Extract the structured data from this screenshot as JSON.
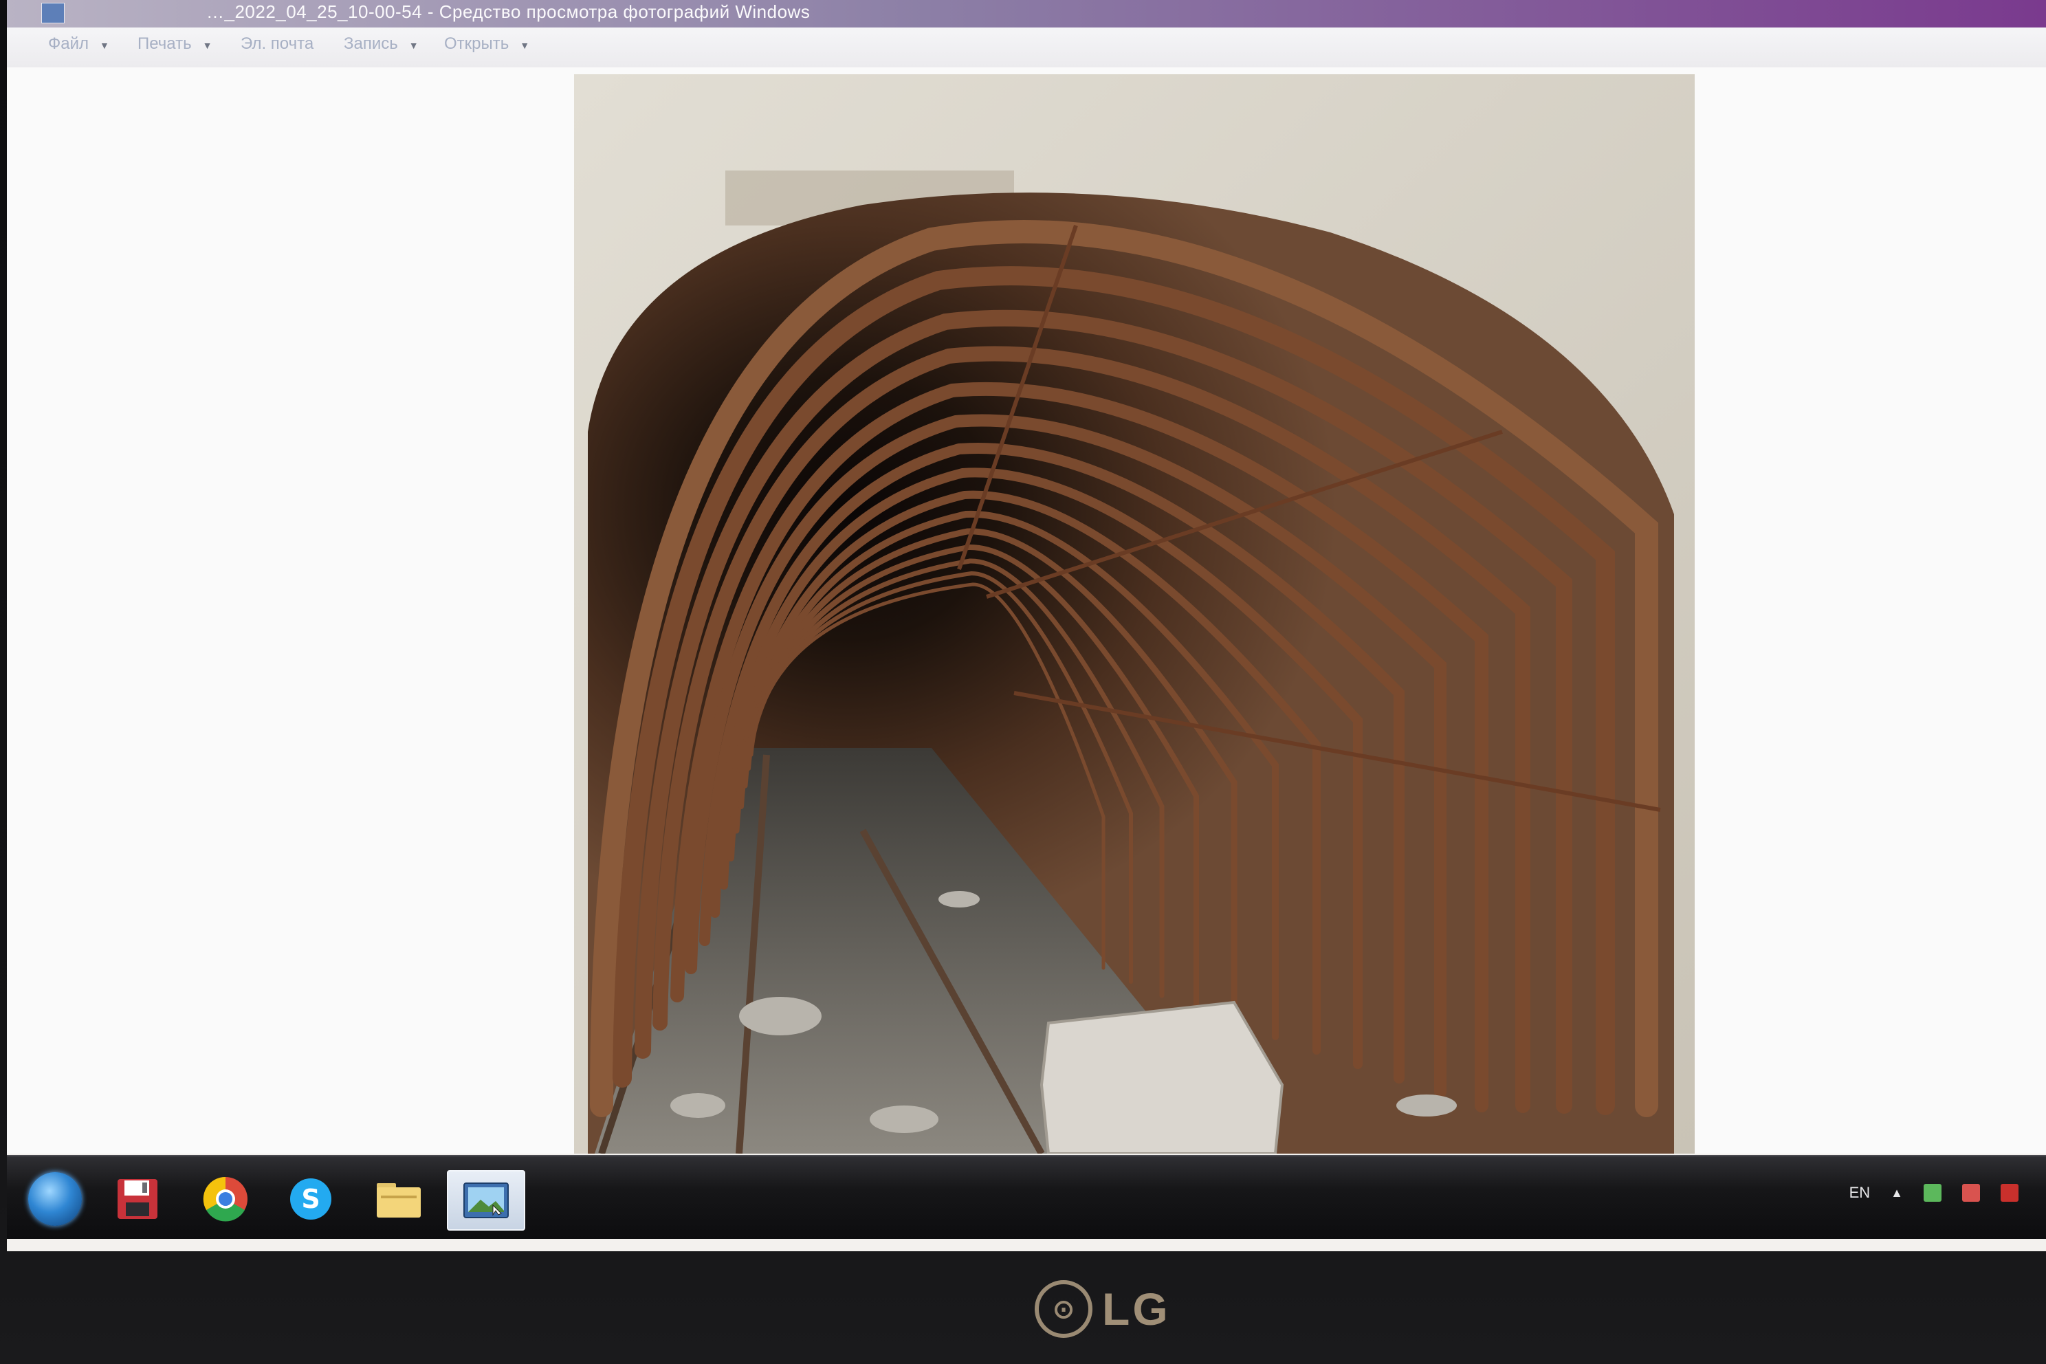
{
  "window": {
    "title": "…_2022_04_25_10-00-54 - Средство просмотра фотографий Windows"
  },
  "menu": {
    "items": [
      {
        "label": "Файл",
        "has_dropdown": true
      },
      {
        "label": "Печать",
        "has_dropdown": true
      },
      {
        "label": "Эл. почта",
        "has_dropdown": false
      },
      {
        "label": "Запись",
        "has_dropdown": true
      },
      {
        "label": "Открыть",
        "has_dropdown": true
      }
    ]
  },
  "photo": {
    "subject": "tunnel-with-rusty-steel-arch-ribs"
  },
  "taskbar": {
    "buttons": [
      {
        "icon": "windows-start-orb-icon"
      },
      {
        "icon": "save-floppy-icon"
      },
      {
        "icon": "chrome-icon"
      },
      {
        "icon": "skype-icon"
      },
      {
        "icon": "file-explorer-folder-icon"
      },
      {
        "icon": "photo-viewer-icon",
        "active": true
      }
    ],
    "tray": {
      "language": "EN"
    }
  },
  "monitor": {
    "brand": "LG"
  },
  "colors": {
    "titlebar_accent": "#7a3a8e",
    "taskbar_bg": "#161618",
    "rust": "#7a4a2e",
    "concrete": "#dcd8cf"
  }
}
